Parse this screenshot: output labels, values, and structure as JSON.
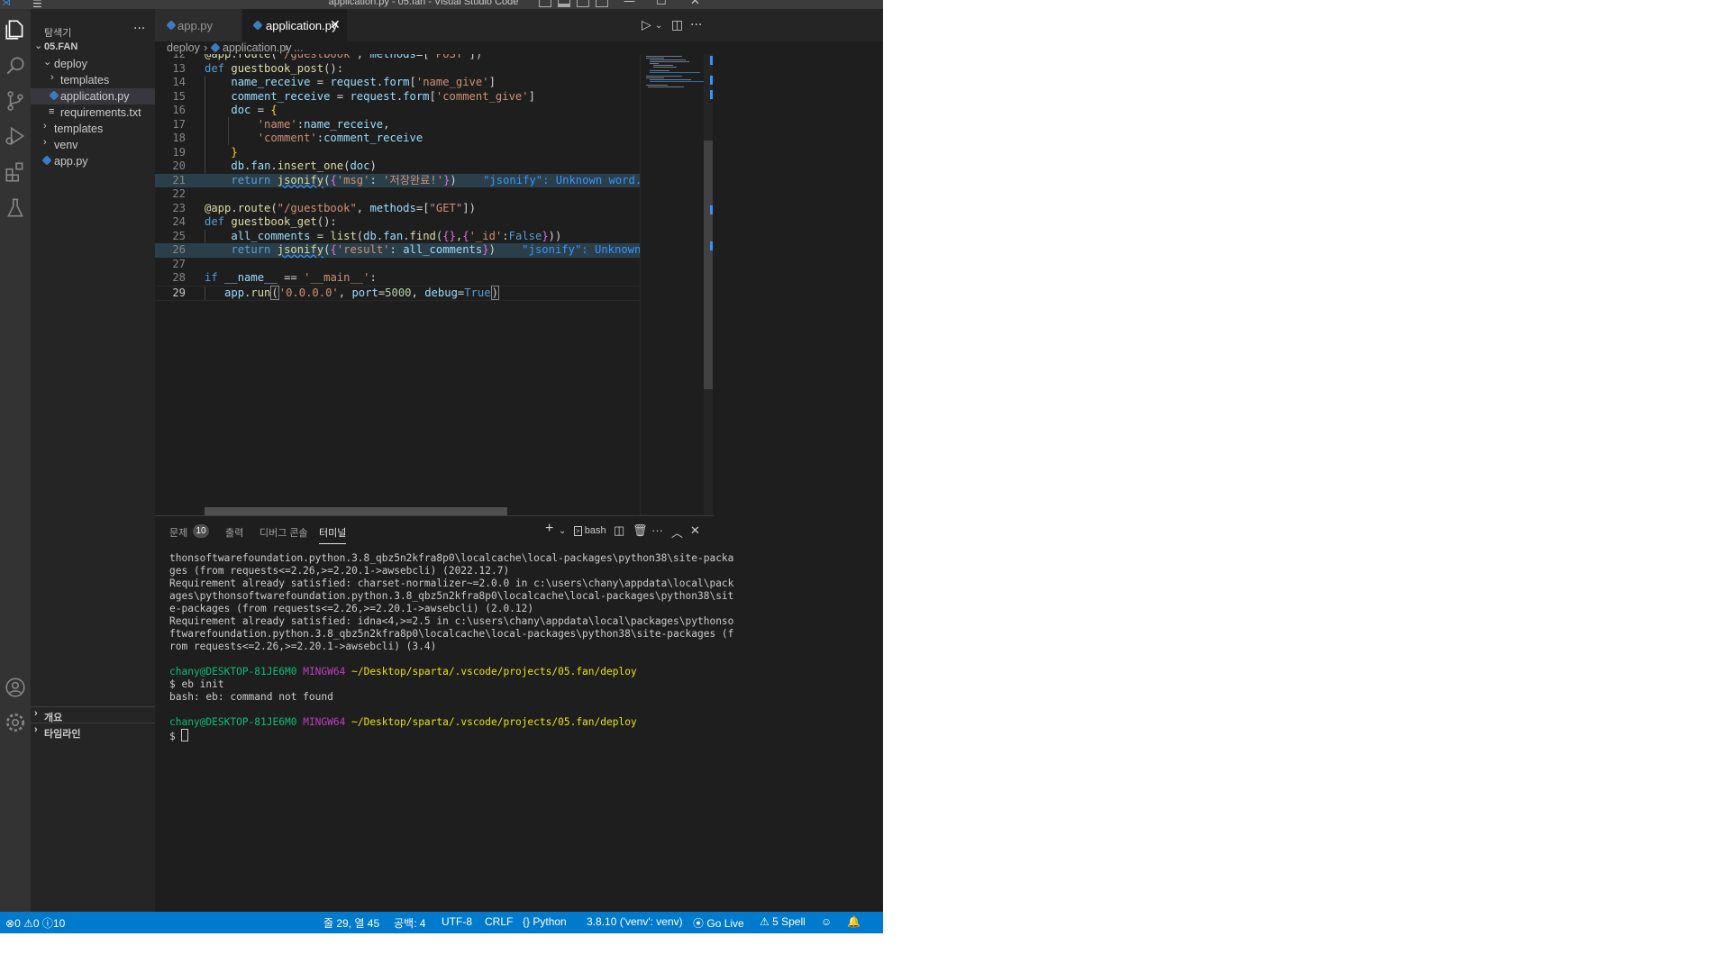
{
  "window": {
    "title": "application.py - 05.fan - Visual Studio Code"
  },
  "sidebar": {
    "header": "탐색기",
    "more": "···",
    "project": "05.FAN",
    "tree": [
      {
        "label": "deploy",
        "kind": "folder-open"
      },
      {
        "label": "templates",
        "kind": "folder"
      },
      {
        "label": "application.py",
        "kind": "py",
        "selected": true
      },
      {
        "label": "requirements.txt",
        "kind": "txt"
      },
      {
        "label": "templates",
        "kind": "folder"
      },
      {
        "label": "venv",
        "kind": "folder"
      },
      {
        "label": "app.py",
        "kind": "py"
      }
    ],
    "outline": "개요",
    "timeline": "타임라인"
  },
  "tabs": [
    {
      "label": "app.py",
      "active": false
    },
    {
      "label": "application.py",
      "active": true
    }
  ],
  "breadcrumb": {
    "folder": "deploy",
    "file": "application.py",
    "rest": "..."
  },
  "editor": {
    "lines": [
      {
        "n": "12",
        "text": "@app.route('/guestbook', methods=['POST'])"
      },
      {
        "n": "13",
        "text": "def guestbook_post():"
      },
      {
        "n": "14",
        "text": "    name_receive = request.form['name_give']"
      },
      {
        "n": "15",
        "text": "    comment_receive = request.form['comment_give']"
      },
      {
        "n": "16",
        "text": "    doc = {"
      },
      {
        "n": "17",
        "text": "        'name':name_receive,"
      },
      {
        "n": "18",
        "text": "        'comment':comment_receive"
      },
      {
        "n": "19",
        "text": "    }"
      },
      {
        "n": "20",
        "text": "    db.fan.insert_one(doc)"
      },
      {
        "n": "21",
        "text": "    return jsonify({'msg': '저장완료!'})"
      },
      {
        "n": "22",
        "text": ""
      },
      {
        "n": "23",
        "text": "@app.route(\"/guestbook\", methods=[\"GET\"])"
      },
      {
        "n": "24",
        "text": "def guestbook_get():"
      },
      {
        "n": "25",
        "text": "    all_comments = list(db.fan.find({},{'_id':False}))"
      },
      {
        "n": "26",
        "text": "    return jsonify({'result': all_comments})"
      },
      {
        "n": "27",
        "text": ""
      },
      {
        "n": "28",
        "text": "if __name__ == '__main__':"
      },
      {
        "n": "29",
        "text": "   app.run('0.0.0.0', port=5000, debug=True)"
      }
    ],
    "hint_21": "\"jsonify\": Unknown word.",
    "hint_26": "\"jsonify\": Unknown word.",
    "active_line": "29"
  },
  "panel": {
    "tabs": [
      "문제",
      "출력",
      "디버그 콘솔",
      "터미널"
    ],
    "problems_count": "10",
    "shell": "bash",
    "terminal": [
      "thonsoftwarefoundation.python.3.8_qbz5n2kfra8p0\\localcache\\local-packages\\python38\\site-packa",
      "ges (from requests<=2.26,>=2.20.1->awsebcli) (2022.12.7)",
      "Requirement already satisfied: charset-normalizer~=2.0.0 in c:\\users\\chany\\appdata\\local\\pack",
      "ages\\pythonsoftwarefoundation.python.3.8_qbz5n2kfra8p0\\localcache\\local-packages\\python38\\sit",
      "e-packages (from requests<=2.26,>=2.20.1->awsebcli) (2.0.12)",
      "Requirement already satisfied: idna<4,>=2.5 in c:\\users\\chany\\appdata\\local\\packages\\pythonso",
      "ftwarefoundation.python.3.8_qbz5n2kfra8p0\\localcache\\local-packages\\python38\\site-packages (f",
      "rom requests<=2.26,>=2.20.1->awsebcli) (3.4)"
    ],
    "prompt_user": "chany@DESKTOP-81JE6M0",
    "prompt_shell": "MINGW64",
    "prompt_path": "~/Desktop/sparta/.vscode/projects/05.fan/deploy",
    "cmd1": "$ eb init",
    "err1": "bash: eb: command not found",
    "prompt2": "$ "
  },
  "status": {
    "errors": "0",
    "warnings": "0",
    "info": "10",
    "position": "줄 29, 열 45",
    "spaces": "공백: 4",
    "encoding": "UTF-8",
    "eol": "CRLF",
    "language": "Python",
    "interpreter": "3.8.10 ('venv': venv)",
    "golive": "Go Live",
    "spell": "5 Spell"
  }
}
